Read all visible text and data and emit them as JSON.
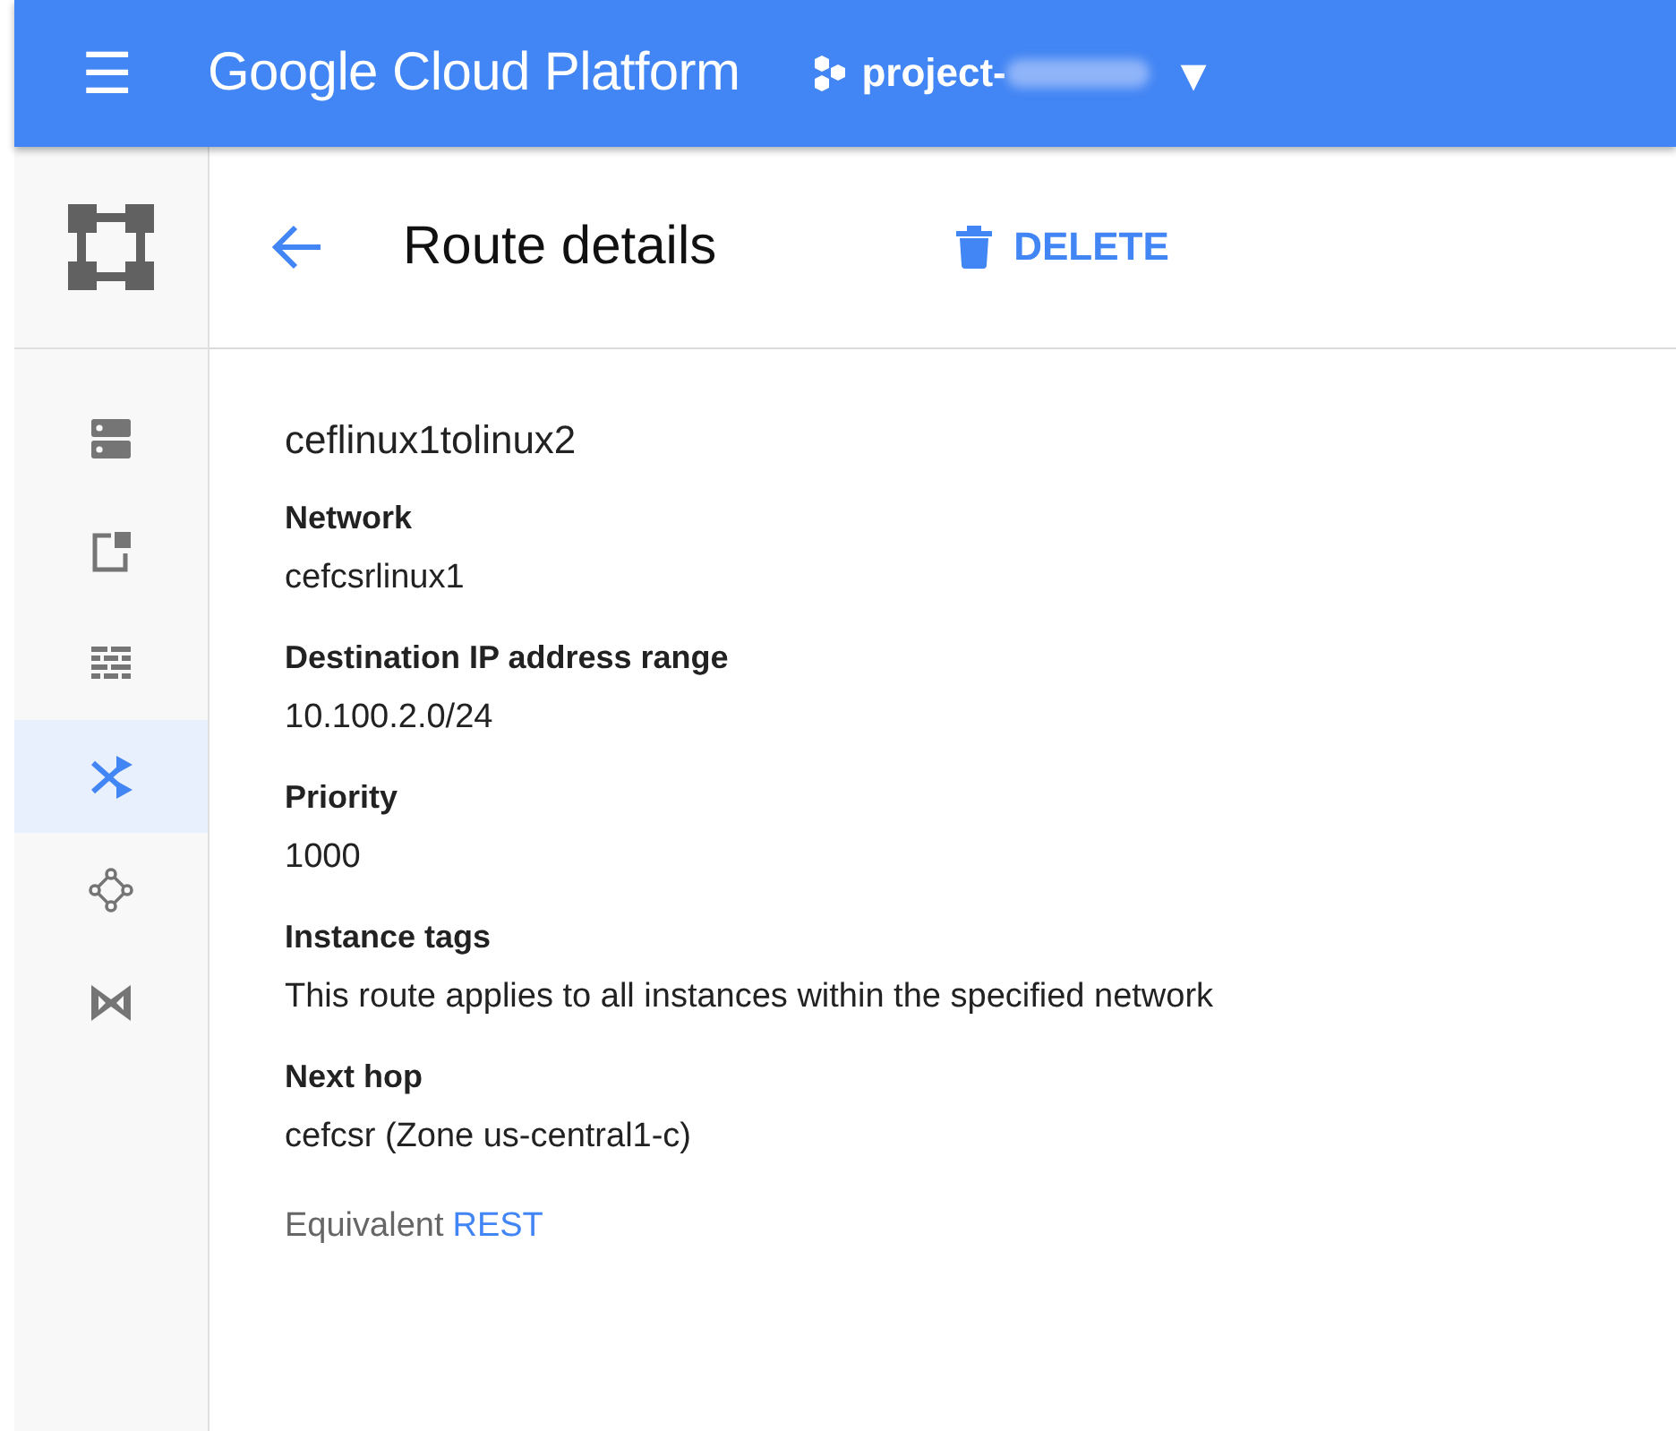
{
  "header": {
    "menu": "☰",
    "product": "Google Cloud Platform",
    "project": "project-",
    "dropdown": "▾"
  },
  "sidebar": {
    "items": [
      {
        "kind": "servers",
        "selected": false
      },
      {
        "kind": "window",
        "selected": false
      },
      {
        "kind": "bricks",
        "selected": false
      },
      {
        "kind": "shuffle",
        "selected": true
      },
      {
        "kind": "nodes",
        "selected": false
      },
      {
        "kind": "bowtie",
        "selected": false
      }
    ]
  },
  "page": {
    "title": "Route details",
    "delete": "DELETE"
  },
  "route": {
    "name": "ceflinux1tolinux2",
    "fields": [
      {
        "label": "Network",
        "value": "cefcsrlinux1"
      },
      {
        "label": "Destination IP address range",
        "value": "10.100.2.0/24"
      },
      {
        "label": "Priority",
        "value": "1000"
      },
      {
        "label": "Instance tags",
        "value": "This route applies to all instances within the specified network"
      },
      {
        "label": "Next hop",
        "value": "cefcsr (Zone us-central1-c)"
      }
    ]
  },
  "footer": {
    "text": "Equivalent",
    "link": "REST"
  }
}
